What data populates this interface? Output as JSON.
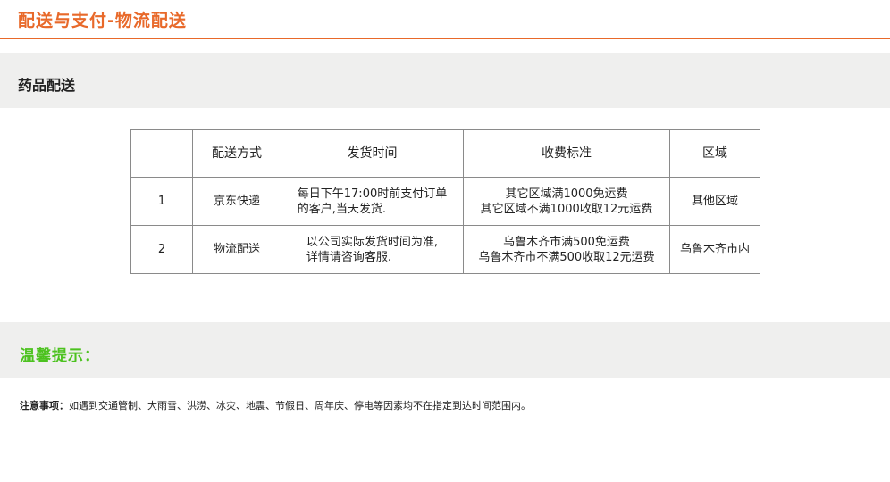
{
  "header": {
    "title": "配送与支付-物流配送"
  },
  "section": {
    "title": "药品配送"
  },
  "table": {
    "columns": [
      "",
      "配送方式",
      "发货时间",
      "收费标准",
      "区域"
    ],
    "rows": [
      {
        "index": "1",
        "method": "京东快递",
        "ship_time": [
          "每日下午17:00时前支付订单",
          "的客户,当天发货."
        ],
        "fees": [
          "其它区域满1000免运费",
          "其它区域不满1000收取12元运费"
        ],
        "region": "其他区域"
      },
      {
        "index": "2",
        "method": "物流配送",
        "ship_time": [
          "以公司实际发货时间为准,",
          "详情请咨询客服."
        ],
        "fees": [
          "乌鲁木齐市满500免运费",
          "乌鲁木齐市不满500收取12元运费"
        ],
        "region": "乌鲁木齐市内"
      }
    ]
  },
  "tips": {
    "title": "温馨提示：",
    "notice_label": "注意事项：",
    "notice_text": "如遇到交通管制、大雨雪、洪涝、冰灾、地震、节假日、周年庆、停电等因素均不在指定到达时间范围内。"
  },
  "colors": {
    "accent": "#e8692a",
    "tip_green": "#4cc21f",
    "band_gray": "#efefee",
    "border": "#8a8a8a"
  }
}
